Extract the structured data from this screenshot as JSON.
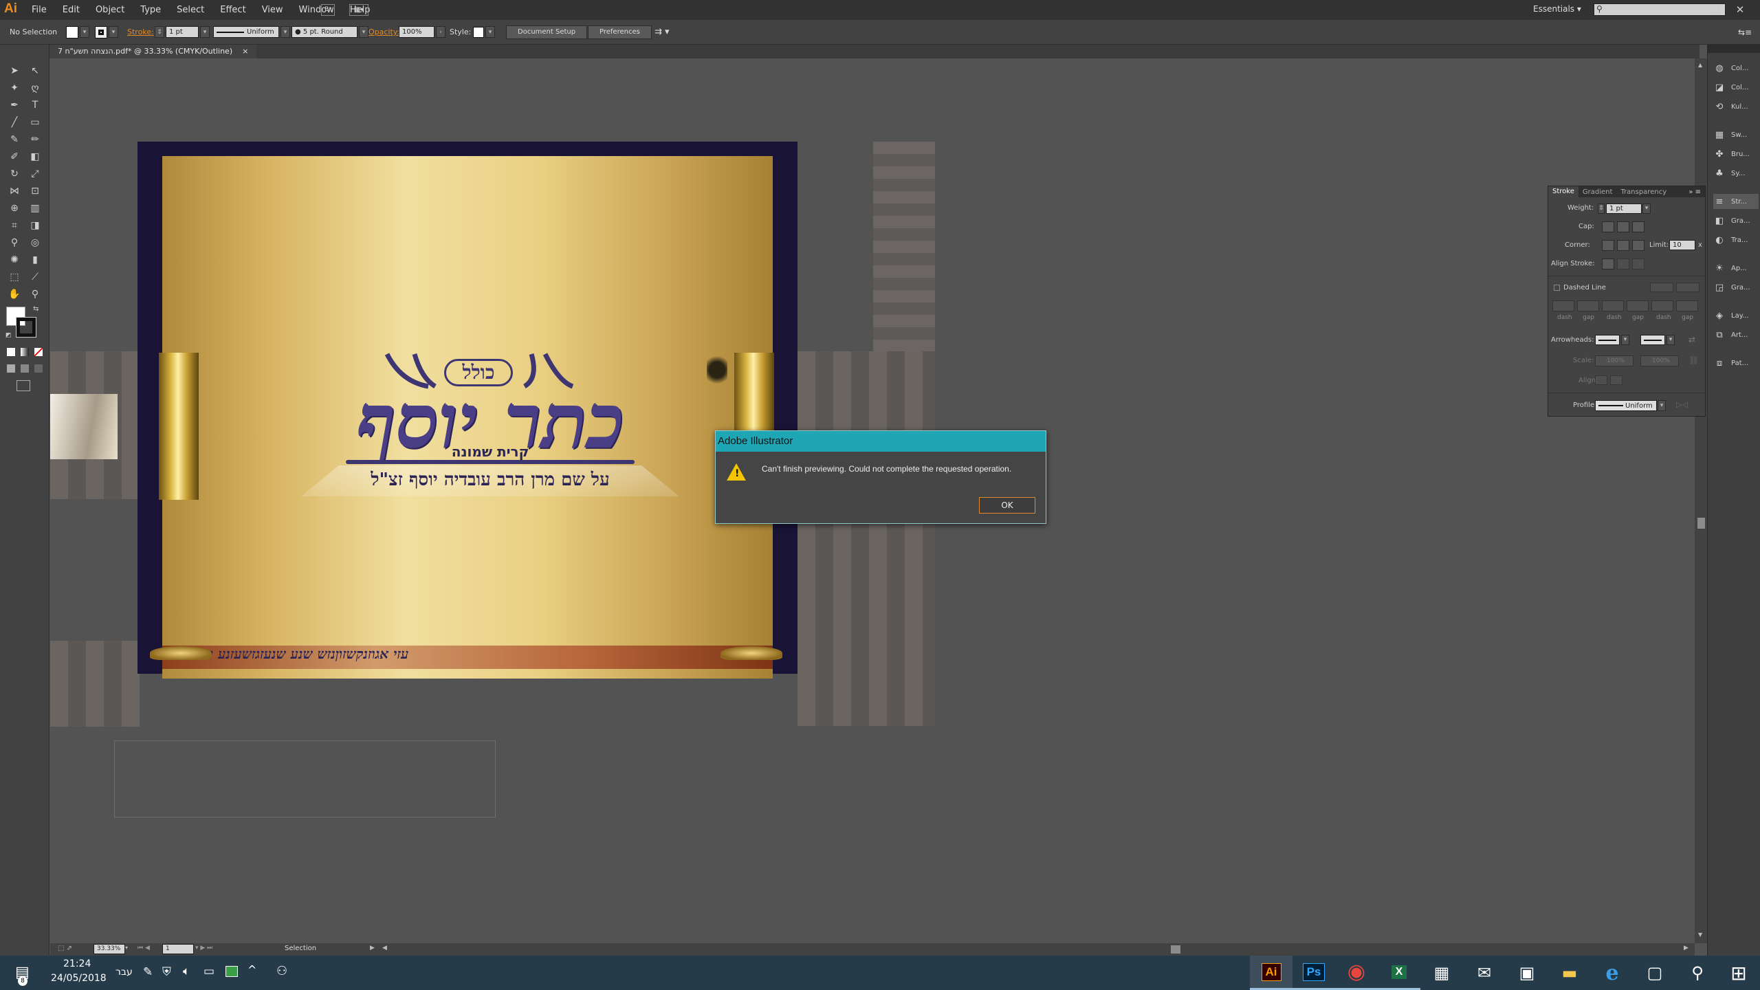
{
  "app": {
    "logo": "Ai",
    "menu": [
      "File",
      "Edit",
      "Object",
      "Type",
      "Select",
      "Effect",
      "View",
      "Window",
      "Help"
    ],
    "bridge_label": "Br",
    "workspace": "Essentials",
    "search_placeholder": ""
  },
  "control_bar": {
    "selection": "No Selection",
    "stroke_label": "Stroke:",
    "stroke_weight": "1 pt",
    "profile": "Uniform",
    "brush": "5 pt. Round",
    "opacity_label": "Opacity:",
    "opacity": "100%",
    "style_label": "Style:",
    "document_setup": "Document Setup",
    "preferences": "Preferences"
  },
  "document": {
    "tab_title": "7 הנצחה תשע\"ח.pdf* @ 33.33% (CMYK/Outline)",
    "close": "×"
  },
  "artwork": {
    "top_word": "כולל",
    "title": "כתר יוסף",
    "subtitle": "קרית שמונה",
    "dedication": "על שם מרן הרב עובדיה יוסף זצ\"ל",
    "bottom_strip": "עזי אגוזנקשזוןנזש שנע שנעזגזשעזנע עזי"
  },
  "status": {
    "zoom": "33.33%",
    "page": "1",
    "tool": "Selection"
  },
  "dock": {
    "items": [
      {
        "label": "Col...",
        "icon": "color-icon"
      },
      {
        "label": "Col...",
        "icon": "color-guide-icon"
      },
      {
        "label": "Kul...",
        "icon": "kuler-icon"
      },
      {
        "label": "Sw...",
        "icon": "swatches-icon"
      },
      {
        "label": "Bru...",
        "icon": "brushes-icon"
      },
      {
        "label": "Sy...",
        "icon": "symbols-icon"
      },
      {
        "label": "Str...",
        "icon": "stroke-icon"
      },
      {
        "label": "Gra...",
        "icon": "gradient-icon"
      },
      {
        "label": "Tra...",
        "icon": "transparency-icon"
      },
      {
        "label": "Ap...",
        "icon": "appearance-icon"
      },
      {
        "label": "Gra...",
        "icon": "graphic-styles-icon"
      },
      {
        "label": "Lay...",
        "icon": "layers-icon"
      },
      {
        "label": "Art...",
        "icon": "artboards-icon"
      },
      {
        "label": "Pat...",
        "icon": "pathfinder-icon"
      }
    ]
  },
  "stroke_panel": {
    "tabs": [
      "Stroke",
      "Gradient",
      "Transparency"
    ],
    "weight_label": "Weight:",
    "weight": "1 pt",
    "cap_label": "Cap:",
    "corner_label": "Corner:",
    "limit_label": "Limit:",
    "limit": "10",
    "limit_unit": "x",
    "align_label": "Align Stroke:",
    "dashed_label": "Dashed Line",
    "dash_labels": [
      "dash",
      "gap",
      "dash",
      "gap",
      "dash",
      "gap"
    ],
    "arrowheads_label": "Arrowheads:",
    "scale_label": "Scale:",
    "scale1": "100%",
    "scale2": "100%",
    "align2_label": "Align:",
    "profile_label": "Profile:",
    "profile": "Uniform"
  },
  "dialog": {
    "title": "Adobe Illustrator",
    "message": "Can't finish previewing. Could not complete the requested operation.",
    "ok": "OK"
  },
  "taskbar": {
    "time": "21:24",
    "date": "24/05/2018",
    "lang": "עבר",
    "notification_count": "8",
    "apps": [
      {
        "name": "illustrator-icon",
        "glyph": "Ai"
      },
      {
        "name": "photoshop-icon",
        "glyph": "Ps"
      },
      {
        "name": "chrome-icon",
        "glyph": "◉"
      },
      {
        "name": "excel-icon",
        "glyph": "X"
      },
      {
        "name": "calculator-icon",
        "glyph": "▦"
      },
      {
        "name": "mail-icon",
        "glyph": "✉"
      },
      {
        "name": "store-icon",
        "glyph": "▣"
      },
      {
        "name": "file-explorer-icon",
        "glyph": "▬"
      },
      {
        "name": "edge-icon",
        "glyph": "e"
      },
      {
        "name": "task-view-icon",
        "glyph": "▢"
      },
      {
        "name": "search-icon",
        "glyph": "⚲"
      },
      {
        "name": "start-icon",
        "glyph": "⊞"
      }
    ]
  },
  "colors": {
    "accent": "#1fa6b5",
    "illustrator_orange": "#f08c1b",
    "taskbar": "#263b4a"
  }
}
